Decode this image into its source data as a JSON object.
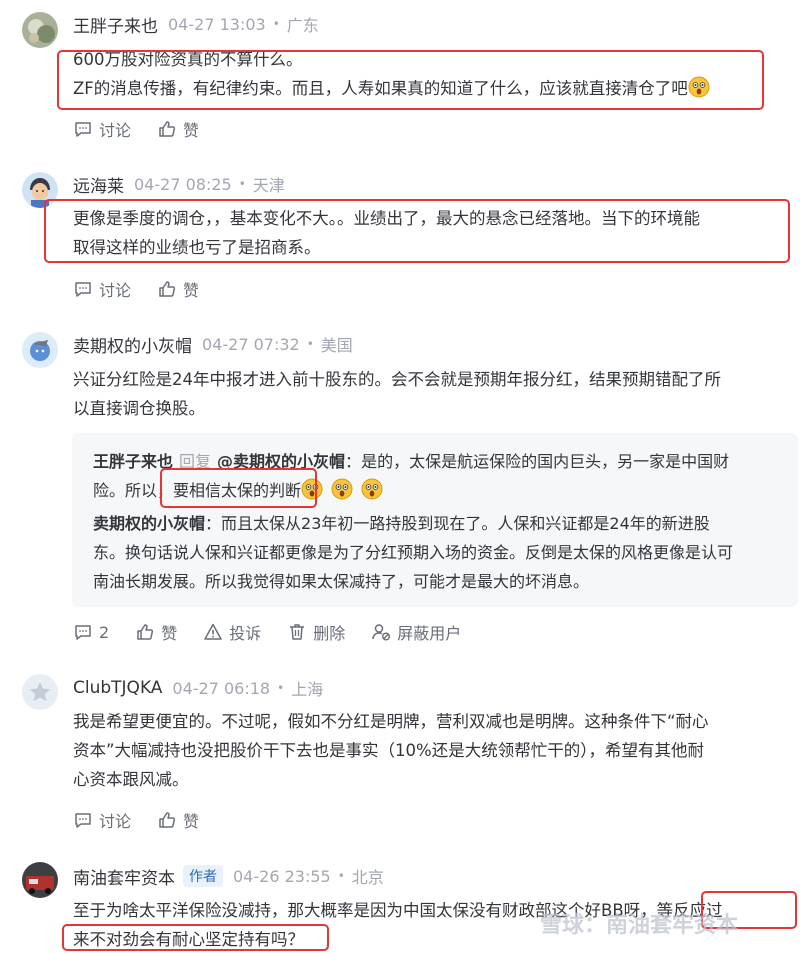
{
  "comments": [
    {
      "user": "王胖子来也",
      "time": "04-27 13:03",
      "location": "广东",
      "lines": [
        "600万股对险资真的不算什么。",
        "ZF的消息传播，有纪律约束。而且，人寿如果真的知道了什么，应该就直接清仓了吧"
      ],
      "actions": {
        "discuss": "讨论",
        "like": "赞"
      }
    },
    {
      "user": "远海莱",
      "time": "04-27 08:25",
      "location": "天津",
      "lines": [
        "更像是季度的调仓，，基本变化不大。。业绩出了，最大的悬念已经落地。当下的环境能",
        "取得这样的业绩也亏了是招商系。"
      ],
      "actions": {
        "discuss": "讨论",
        "like": "赞"
      }
    },
    {
      "user": "卖期权的小灰帽",
      "time": "04-27 07:32",
      "location": "美国",
      "lines": [
        "兴证分红险是24年中报才进入前十股东的。会不会就是预期年报分红，结果预期错配了所",
        "以直接调仓换股。"
      ],
      "reply": {
        "user": "王胖子来也",
        "reply_word": "回复",
        "target": "@卖期权的小灰帽",
        "colon": "：",
        "line1": "是的，太保是航运保险的国内巨头，另一家是中国财",
        "line2_pre": "险。所以，",
        "line2_highlight": "要相信太保的判断"
      },
      "followup": {
        "user": "卖期权的小灰帽",
        "colon": "：",
        "line1": "而且太保从23年初一路持股到现在了。人保和兴证都是24年的新进股",
        "line2": "东。换句话说人保和兴证都更像是为了分红预期入场的资金。反倒是太保的风格更像是认可",
        "line3": "南油长期发展。所以我觉得如果太保减持了，可能才是最大的坏消息。"
      },
      "actions": {
        "discuss_count": "2",
        "like": "赞",
        "report": "投诉",
        "delete": "删除",
        "block": "屏蔽用户"
      }
    },
    {
      "user": "ClubTJQKA",
      "time": "04-27 06:18",
      "location": "上海",
      "lines": [
        "我是希望更便宜的。不过呢，假如不分红是明牌，营利双减也是明牌。这种条件下“耐心",
        "资本”大幅减持也没把股价干下去也是事实（10%还是大统领帮忙干的），希望有其他耐",
        "心资本跟风减。"
      ],
      "actions": {
        "discuss": "讨论",
        "like": "赞"
      }
    },
    {
      "user": "南油套牢资本",
      "author_tag": "作者",
      "time": "04-26 23:55",
      "location": "北京",
      "line1_pre": "至于为啥太平洋保险没减持，那大概率是因为中国太保没有财政部这个好BB呀，",
      "line1_highlight": "等反应过",
      "line2": "来不对劲会有耐心坚定持有吗？"
    }
  ],
  "separator_dot": "•",
  "watermark": "雪球：南油套牢资本",
  "colors": {
    "highlight_border": "#e53535",
    "muted": "#a3a7b3",
    "reply_bg": "#f6f7f9"
  }
}
